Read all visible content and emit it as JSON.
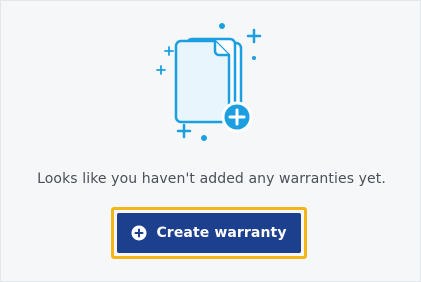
{
  "empty_state": {
    "message": "Looks like you haven't added any warranties yet.",
    "illustration_icon": "documents-add-icon"
  },
  "actions": {
    "create_label": "Create warranty",
    "create_icon": "plus-circle-icon"
  },
  "colors": {
    "accent_blue": "#1c3f8e",
    "focus_ring": "#f5b417",
    "illustration_blue": "#1b9fe0",
    "illustration_fill": "#ffffff"
  }
}
